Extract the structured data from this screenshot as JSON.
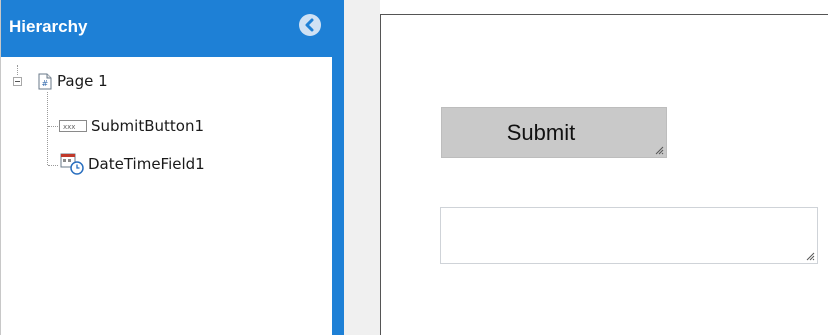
{
  "hierarchy": {
    "title": "Hierarchy",
    "tree": {
      "page": {
        "label": "Page 1",
        "expanded": true
      },
      "children": [
        {
          "label": "SubmitButton1",
          "icon": "button-field-icon"
        },
        {
          "label": "DateTimeField1",
          "icon": "datetime-field-icon"
        }
      ]
    }
  },
  "canvas": {
    "submit_button": {
      "label": "Submit"
    },
    "datetime_field": {
      "value": ""
    }
  },
  "colors": {
    "accent": "#1e80d6",
    "button_bg": "#c9c9c9"
  }
}
